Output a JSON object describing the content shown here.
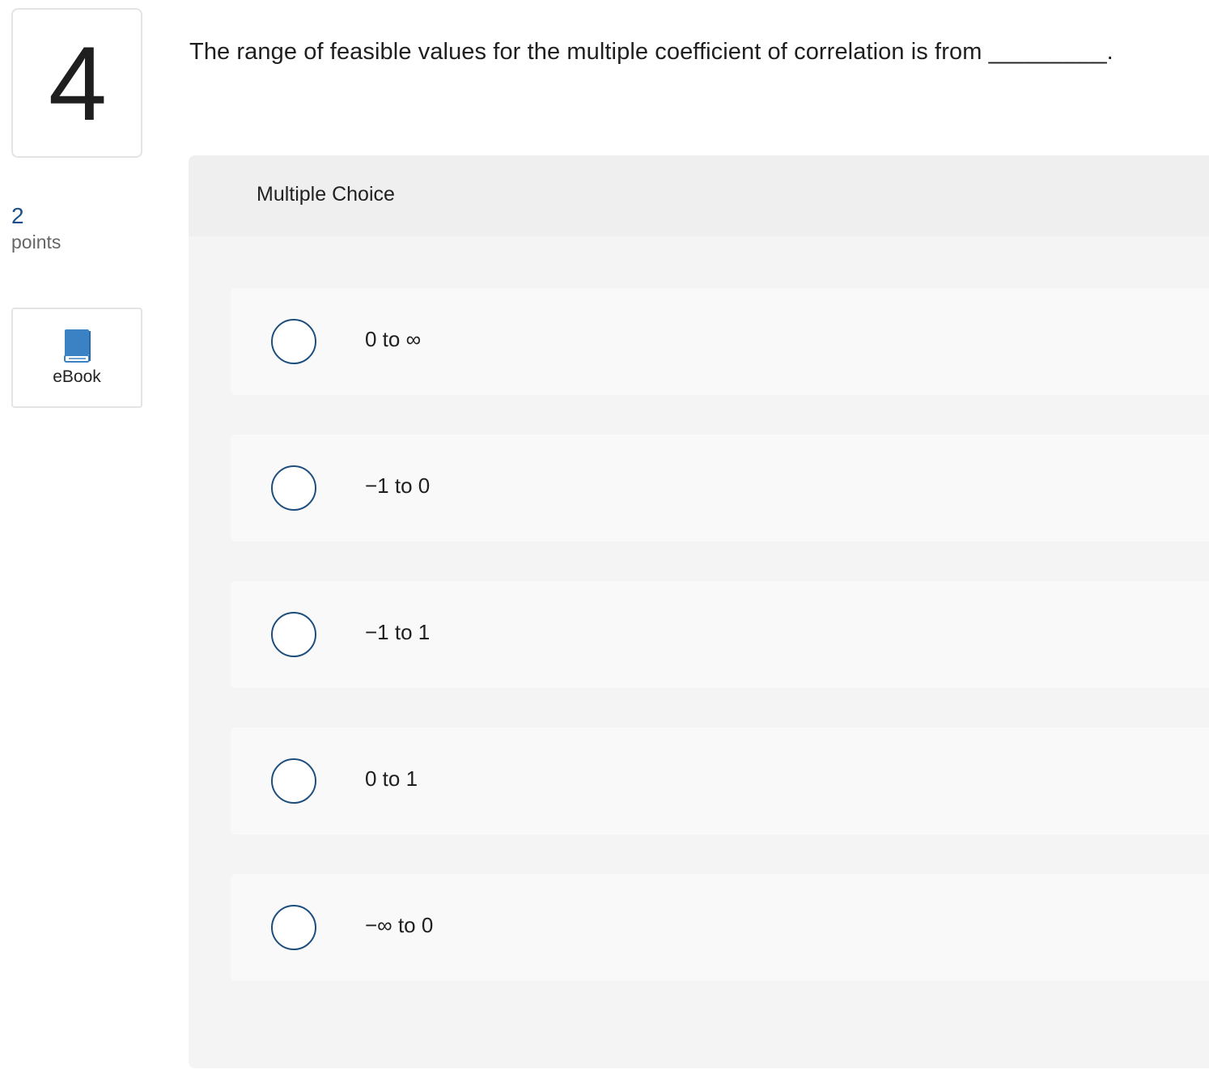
{
  "question": {
    "number": "4",
    "points_value": "2",
    "points_label": "points",
    "text": "The range of feasible values for the multiple coefficient of correlation is from _________."
  },
  "ebook": {
    "label": "eBook",
    "icon": "book-icon"
  },
  "answer_panel": {
    "type_label": "Multiple Choice",
    "choices": [
      {
        "label": "0 to ∞"
      },
      {
        "label": "−1 to 0"
      },
      {
        "label": "−1 to 1"
      },
      {
        "label": "0 to 1"
      },
      {
        "label": "−∞ to 0"
      }
    ]
  },
  "colors": {
    "accent": "#1d4e7e",
    "points_value": "#1b4f8a",
    "ebook_icon": "#3b82c4",
    "panel_bg": "#f4f4f4",
    "choice_bg": "#f9f9f9"
  }
}
